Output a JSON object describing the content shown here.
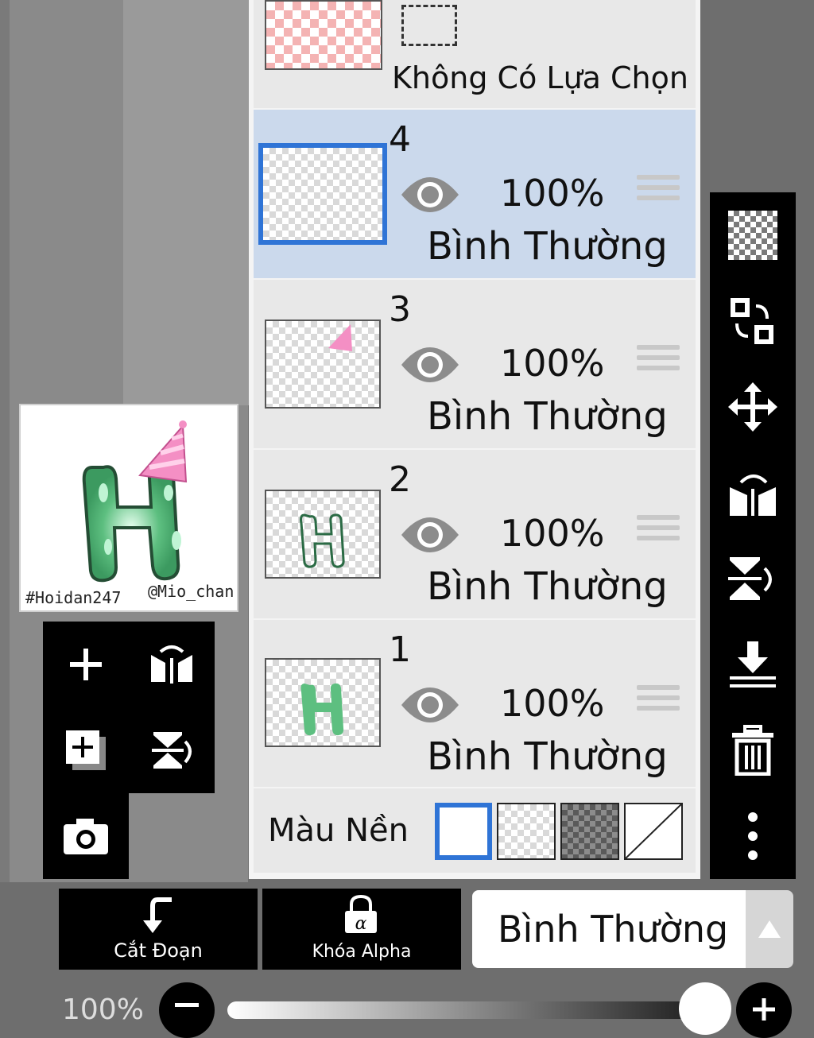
{
  "layer_panel": {
    "selection_layer": {
      "label": "Không Có Lựa Chọn"
    },
    "layers": [
      {
        "number": "4",
        "opacity": "100%",
        "blend": "Bình Thường",
        "selected": true
      },
      {
        "number": "3",
        "opacity": "100%",
        "blend": "Bình Thường",
        "selected": false
      },
      {
        "number": "2",
        "opacity": "100%",
        "blend": "Bình Thường",
        "selected": false
      },
      {
        "number": "1",
        "opacity": "100%",
        "blend": "Bình Thường",
        "selected": false
      }
    ],
    "background": {
      "label": "Màu Nền",
      "options": [
        "white",
        "transparent-light",
        "transparent-dark",
        "none"
      ],
      "selected": "white"
    }
  },
  "preview": {
    "tag_left": "#Hoidan247",
    "tag_right": "@Mio_chan"
  },
  "bottom_bar": {
    "clip_label": "Cắt Đoạn",
    "alpha_lock_label": "Khóa Alpha",
    "blend_mode": "Bình Thường"
  },
  "opacity_slider": {
    "label": "100%",
    "value": 1.0
  },
  "icons": {
    "left_tools": [
      "plus-icon",
      "flip-horizontal-icon",
      "add-layer-icon",
      "flip-vertical-icon",
      "camera-icon"
    ],
    "right_tools": [
      "checker-icon",
      "swap-layer-icon",
      "move-icon",
      "flip-horizontal-icon",
      "flip-vertical-icon",
      "merge-down-icon",
      "trash-icon",
      "more-icon"
    ]
  },
  "colors": {
    "selection_blue": "#2f74d6",
    "selected_row": "#cbd9ec",
    "panel": "#e8e8e8"
  }
}
